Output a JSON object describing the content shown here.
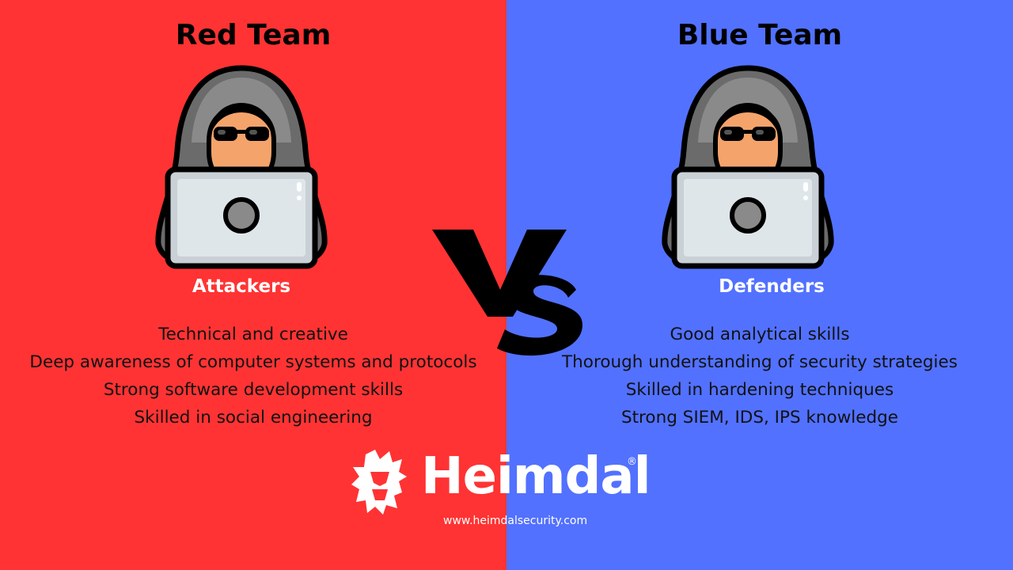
{
  "left": {
    "title": "Red Team",
    "role": "Attackers",
    "skills": [
      "Technical and creative",
      "Deep awareness of computer systems and protocols",
      "Strong software development skills",
      "Skilled in social engineering"
    ],
    "background_color": "#ff3333"
  },
  "right": {
    "title": "Blue Team",
    "role": "Defenders",
    "skills": [
      "Good analytical skills",
      "Thorough understanding of security strategies",
      "Skilled in hardening techniques",
      "Strong SIEM, IDS, IPS knowledge"
    ],
    "background_color": "#5271ff"
  },
  "center": {
    "vs_icon": "vs-glyph"
  },
  "brand": {
    "name": "Heimdal",
    "registered_mark": "®",
    "url": "www.heimdalsecurity.com",
    "logo_icon": "viking-head-icon"
  },
  "icons": {
    "hacker": "hooded-hacker-laptop-icon"
  }
}
